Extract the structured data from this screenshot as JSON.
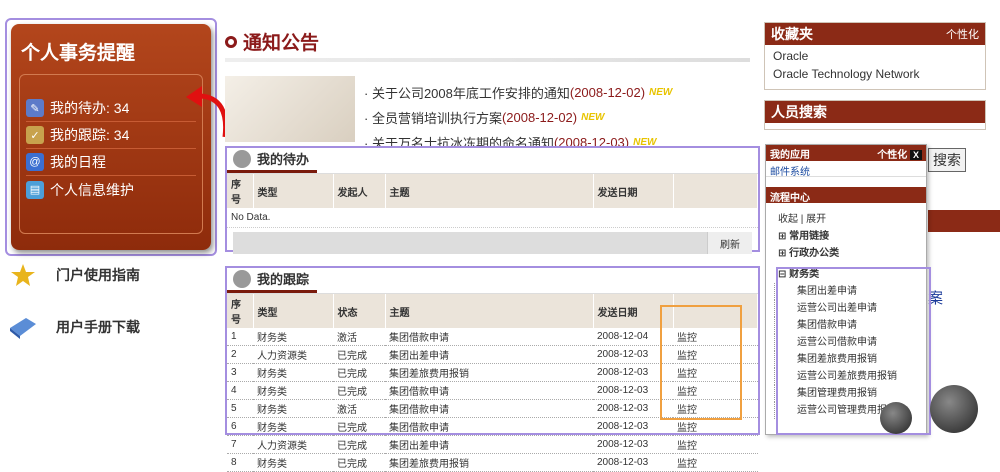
{
  "reminder": {
    "title": "个人事务提醒",
    "items": [
      {
        "label": "我的待办",
        "count": ": 34"
      },
      {
        "label": "我的跟踪",
        "count": ": 34"
      },
      {
        "label": "我的日程",
        "count": ""
      },
      {
        "label": "个人信息维护",
        "count": ""
      }
    ]
  },
  "guides": [
    {
      "label": "门户使用指南"
    },
    {
      "label": "用户手册下载"
    }
  ],
  "notice": {
    "title": "通知公告",
    "items": [
      {
        "text": "· 关于公司2008年底工作安排的通知",
        "date": "(2008-12-02)",
        "badge": "NEW"
      },
      {
        "text": "· 全员营销培训执行方案",
        "date": "(2008-12-02)",
        "badge": "NEW"
      },
      {
        "text": "· 关于万名士抗冰冻期的命名通知",
        "date": "(2008-12-03)",
        "badge": "NEW"
      }
    ]
  },
  "todo": {
    "title": "我的待办",
    "headers": [
      "序号",
      "类型",
      "发起人",
      "主题",
      "发送日期",
      ""
    ],
    "empty": "No Data.",
    "refresh": "刷新"
  },
  "track": {
    "title": "我的跟踪",
    "headers": [
      "序号",
      "类型",
      "状态",
      "主题",
      "发送日期",
      ""
    ],
    "rows": [
      [
        "1",
        "财务类",
        "激活",
        "集团借款申请",
        "2008-12-04",
        "监控"
      ],
      [
        "2",
        "人力资源类",
        "已完成",
        "集团出差申请",
        "2008-12-03",
        "监控"
      ],
      [
        "3",
        "财务类",
        "已完成",
        "集团差旅费用报销",
        "2008-12-03",
        "监控"
      ],
      [
        "4",
        "财务类",
        "已完成",
        "集团借款申请",
        "2008-12-03",
        "监控"
      ],
      [
        "5",
        "财务类",
        "激活",
        "集团借款申请",
        "2008-12-03",
        "监控"
      ],
      [
        "6",
        "财务类",
        "已完成",
        "集团借款申请",
        "2008-12-03",
        "监控"
      ],
      [
        "7",
        "人力资源类",
        "已完成",
        "集团出差申请",
        "2008-12-03",
        "监控"
      ],
      [
        "8",
        "财务类",
        "已完成",
        "集团差旅费用报销",
        "2008-12-03",
        "监控"
      ]
    ]
  },
  "favorites": {
    "title": "收藏夹",
    "action": "个性化",
    "links": [
      "Oracle",
      "Oracle Technology Network"
    ]
  },
  "people": {
    "title": "人员搜索",
    "search_button": "搜索"
  },
  "apps": {
    "title": "我的应用",
    "action": "个性化",
    "close": "X",
    "mail": "邮件系统",
    "flow_title": "流程中心",
    "toggle": "收起 | 展开",
    "groups": [
      "⊞ 常用链接",
      "⊞ 行政办公类",
      "⊟ 财务类"
    ],
    "finance_items": [
      "集团出差申请",
      "运营公司出差申请",
      "集团借款申请",
      "运营公司借款申请",
      "集团差旅费用报销",
      "运营公司差旅费用报销",
      "集团管理费用报销",
      "运营公司管理费用报销"
    ]
  },
  "side_text": "案",
  "colors": {
    "brand": "#8b2a16",
    "highlight": "#a48ee0",
    "monitor": "#f0a040"
  }
}
